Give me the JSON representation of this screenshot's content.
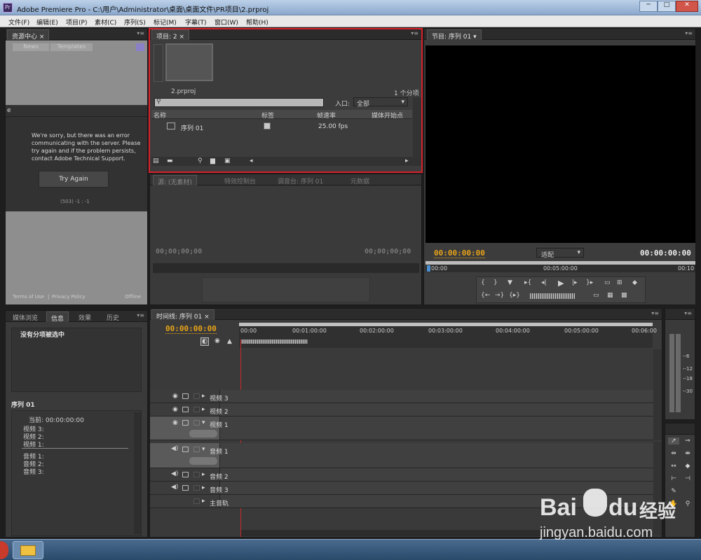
{
  "titlebar": {
    "title": "Adobe Premiere Pro - C:\\用户\\Administrator\\桌面\\桌面文件\\PR项目\\2.prproj",
    "min": "─",
    "max": "□",
    "close": "✕"
  },
  "menu": [
    "文件(F)",
    "编辑(E)",
    "项目(P)",
    "素材(C)",
    "序列(S)",
    "标记(M)",
    "字幕(T)",
    "窗口(W)",
    "帮助(H)"
  ],
  "resource": {
    "tab": "资源中心",
    "tabs": [
      "News",
      "Templates"
    ],
    "error_heading": "e",
    "error_text": "We're sorry, but there was an error communicating with the server. Please try again and if the problem persists, contact Adobe Technical Support.",
    "try_again": "Try Again",
    "code": "(503) -1 : -1",
    "footer_links": [
      "Terms of Use",
      "Privacy Policy"
    ],
    "offline": "Offline"
  },
  "project": {
    "tab": "项目: 2",
    "filename": "2.prproj",
    "item_count": "1 个分项",
    "inlet_label": "入口:",
    "inlet_value": "全部",
    "columns": [
      "名称",
      "标签",
      "帧速率",
      "媒体开始点"
    ],
    "rows": [
      {
        "name": "序列 01",
        "label_color": "#c8c8c8",
        "fps": "25.00 fps"
      }
    ]
  },
  "source": {
    "tabs": [
      "源: (无素材)",
      "特效控制台",
      "调音台: 序列 01",
      "元数据"
    ],
    "tc_left": "00;00;00;00",
    "tc_right": "00;00;00;00"
  },
  "program": {
    "tab": "节目: 序列 01",
    "tc_left": "00:00:00:00",
    "fit": "适配",
    "tc_right": "00:00:00:00",
    "ruler": [
      "00:00",
      "00:05:00:00",
      "00:10"
    ]
  },
  "info": {
    "tabs": [
      "媒体浏览",
      "信息",
      "效果",
      "历史"
    ],
    "no_selection": "没有分项被选中",
    "seq_title": "序列 01",
    "current": "当前: 00:00:00:00",
    "video": [
      "视频 3:",
      "视频 2:",
      "视频 1:"
    ],
    "audio": [
      "音频 1:",
      "音频 2:",
      "音频 3:"
    ]
  },
  "timeline": {
    "tab": "时间线: 序列 01",
    "tc": "00:00:00:00",
    "ruler": [
      "00:00",
      "00:01:00:00",
      "00:02:00:00",
      "00:03:00:00",
      "00:04:00:00",
      "00:05:00:00",
      "00:06:00"
    ],
    "video_tracks": [
      "视频 3",
      "视频 2",
      "视频 1"
    ],
    "audio_tracks": [
      "音频 1",
      "音频 2",
      "音频 3"
    ],
    "master": "主音轨",
    "level_labels": [
      "--6",
      "--12",
      "--18",
      "--30"
    ]
  },
  "watermark": {
    "brand": "Bai",
    "du": "du",
    "jy": "经验",
    "url": "jingyan.baidu.com"
  },
  "colors": {
    "highlight": "#d8202a",
    "timecode": "#e8a317",
    "playhead": "#c82828"
  }
}
